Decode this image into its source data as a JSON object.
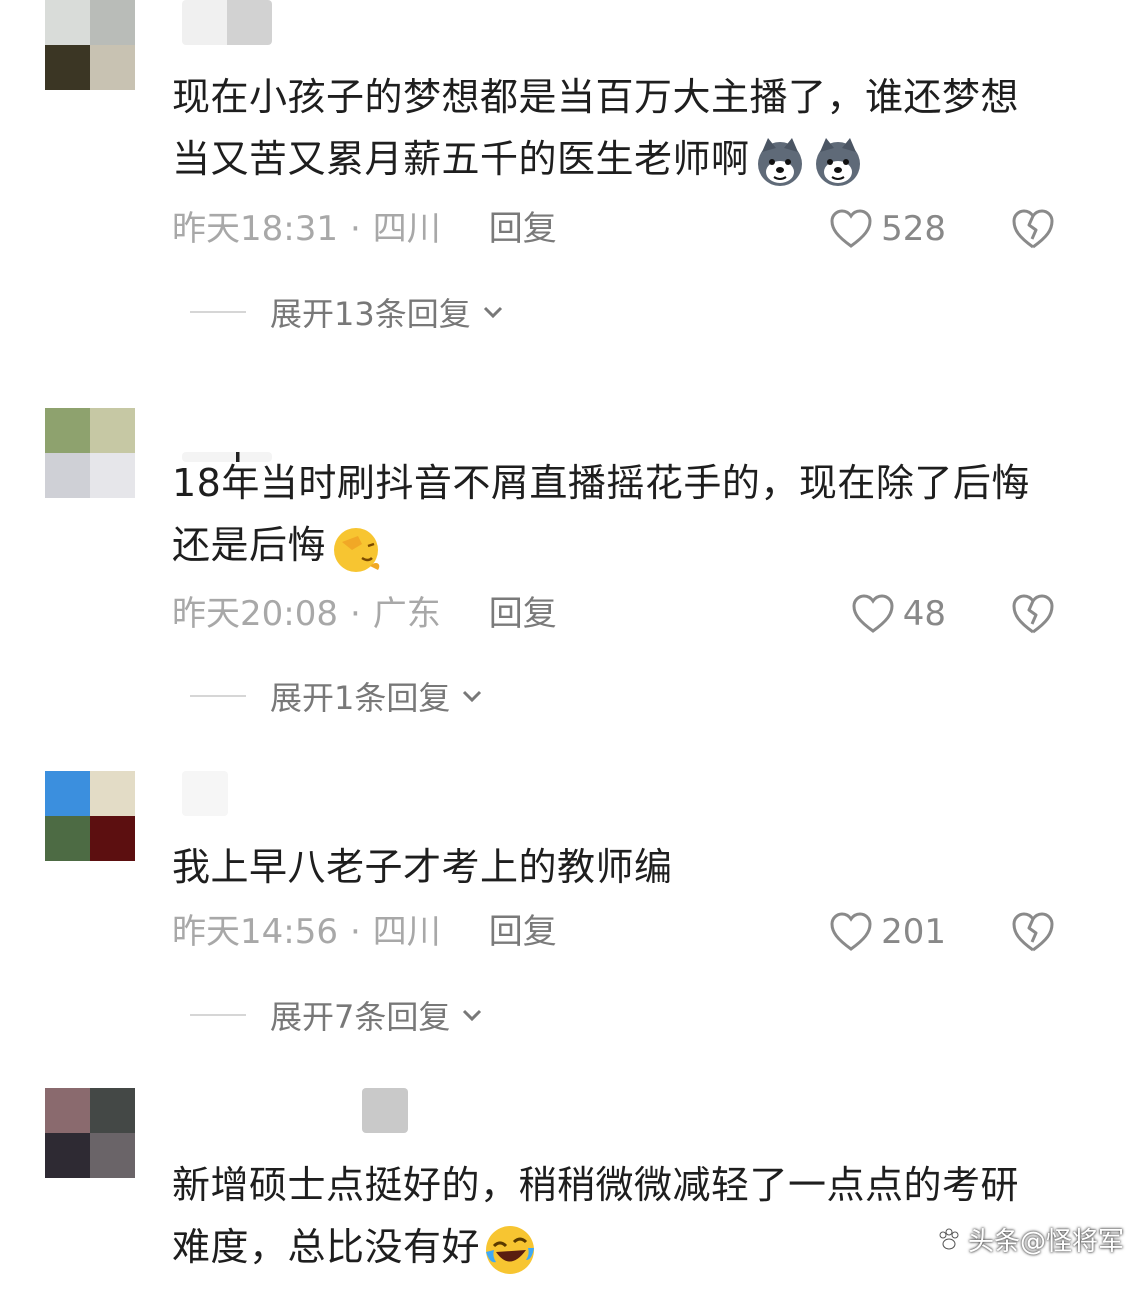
{
  "comments": [
    {
      "text_line1": "现在小孩子的梦想都是当百万大主播了，谁还梦想",
      "text_line2": "当又苦又累月薪五千的医生老师啊",
      "emoji": "husky-dog-emoji",
      "time": "昨天18:31",
      "location": "四川",
      "reply": "回复",
      "likes": "528",
      "expand": "展开13条回复"
    },
    {
      "text_line1": "18年当时刷抖音不屑直播摇花手的，现在除了后悔",
      "text_line2": "还是后悔",
      "emoji": "facepalm-emoji",
      "time": "昨天20:08",
      "location": "广东",
      "reply": "回复",
      "likes": "48",
      "expand": "展开1条回复"
    },
    {
      "text_line1": "我上早八老子才考上的教师编",
      "time": "昨天14:56",
      "location": "四川",
      "reply": "回复",
      "likes": "201",
      "expand": "展开7条回复"
    },
    {
      "text_line1": "新增硕士点挺好的，稍稍微微减轻了一点点的考研",
      "text_line2": "难度，总比没有好",
      "emoji": "rofl-emoji"
    }
  ],
  "separator": "·",
  "watermark": "头条@怪将军",
  "colors": {
    "text": "#1e1e1e",
    "meta": "#a8a8a8",
    "reply": "#7a7a7a",
    "background": "#ffffff"
  }
}
